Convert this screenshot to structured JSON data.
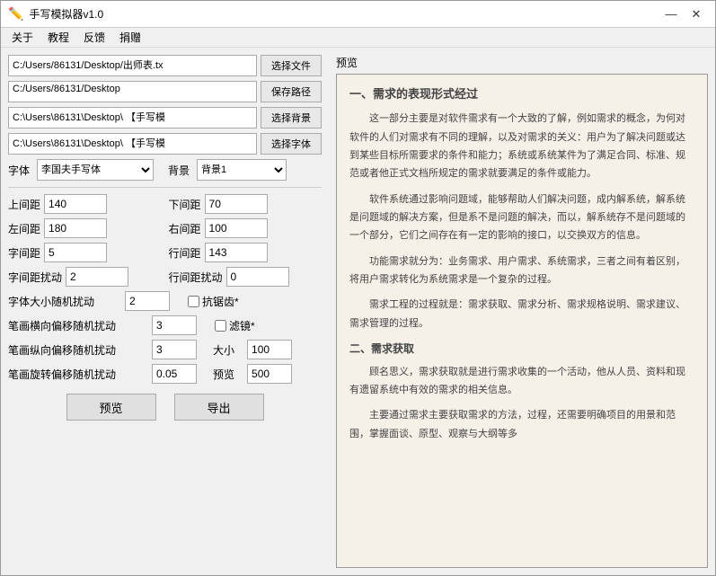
{
  "window": {
    "title": "手写模拟器v1.0",
    "icon": "✏️"
  },
  "titlebar": {
    "minimize": "—",
    "close": "✕"
  },
  "menu": {
    "items": [
      "关于",
      "教程",
      "反馈",
      "捐赠"
    ]
  },
  "files": {
    "source_path": "C:/Users/86131/Desktop/出师表.tx",
    "source_btn": "选择文件",
    "save_path": "C:/Users/86131/Desktop",
    "save_btn": "保存路径",
    "bg_path": "C:\\Users\\86131\\Desktop\\ 【手写模",
    "bg_btn": "选择背景",
    "font_path": "C:\\Users\\86131\\Desktop\\ 【手写模",
    "font_btn": "选择字体"
  },
  "params": {
    "font_label": "字体",
    "font_value": "李国夫手写体",
    "bg_label": "背景",
    "bg_value": "背景1",
    "top_margin_label": "上间距",
    "top_margin_value": "140",
    "bottom_margin_label": "下间距",
    "bottom_margin_value": "70",
    "left_margin_label": "左间距",
    "left_margin_value": "180",
    "right_margin_label": "右间距",
    "right_margin_value": "100",
    "char_spacing_label": "字间距",
    "char_spacing_value": "5",
    "line_spacing_label": "行间距",
    "line_spacing_value": "143",
    "char_disturb_label": "字间距扰动",
    "char_disturb_value": "2",
    "line_disturb_label": "行间距扰动",
    "line_disturb_value": "0",
    "size_disturb_label": "字体大小随机扰动",
    "size_disturb_value": "2",
    "anti_tooth_label": "抗锯齿*",
    "stroke_h_disturb_label": "笔画横向偏移随机扰动",
    "stroke_h_value": "3",
    "lens_label": "滤镜*",
    "stroke_v_disturb_label": "笔画纵向偏移随机扰动",
    "stroke_v_value": "3",
    "size_label": "大小",
    "size_value": "100",
    "stroke_r_disturb_label": "笔画旋转偏移随机扰动",
    "stroke_r_value": "0.05",
    "preview_label": "预览",
    "preview_value": "500"
  },
  "buttons": {
    "preview": "预览",
    "export": "导出"
  },
  "preview": {
    "label": "预览",
    "content_title": "一、需求的表现形式经过",
    "content": [
      "这一部分主要是对软件需求有一个大致的了解，例如需求的概念，为何对软件的人们对需求有不同的理解，以及对需求的关义：用户为了解决问题或达到某些目标所需要求的条件和能力；系统或系统某件为了满足合同、标准、规范或者他正式文档所规定的需求就要满足的条件或能力。",
      "软件系统通过影响问题域，能够帮助人们解决问题，成内解系统，解系统是问题域的解决方案，但是系不是问题的解决，而以，解系统存不是问题域的一个部分，它们之间存在有一定的影响的接口，以交换双方的信息。",
      "功能需求就分为：业务需求、用户需求、系统需求，三者之间有着区别，将用户需求转化为系统需求是一个复杂的过程。",
      "需求工程的过程就是：需求获取、需求分析、需求规格说明、需求建议、需求管理的过程。",
      "二、需求获取",
      "顾名思义，需求获取就是进行需求收集的一个活动，他从人员、资料和现有遗留系统中有效的需求的相关信息。",
      "主要通过需求主要获取需求的方法，过程，还需要明确项目的用景和范围，掌握面谈、原型、观察与大纲等多"
    ]
  }
}
